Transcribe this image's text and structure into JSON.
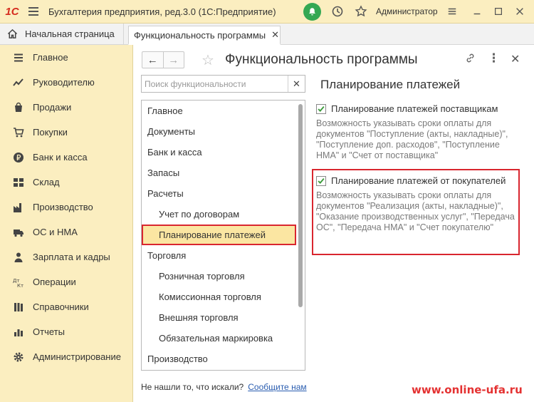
{
  "titlebar": {
    "logo": "1С",
    "app_title": "Бухгалтерия предприятия, ред.3.0  (1С:Предприятие)",
    "user_name": "Администратор"
  },
  "tabs": {
    "home_label": "Начальная страница",
    "active_label": "Функциональность программы",
    "close_glyph": "✕"
  },
  "sidebar": {
    "items": [
      {
        "label": "Главное",
        "icon": "menu-lines-icon"
      },
      {
        "label": "Руководителю",
        "icon": "trend-chart-icon"
      },
      {
        "label": "Продажи",
        "icon": "shopping-bag-icon"
      },
      {
        "label": "Покупки",
        "icon": "cart-icon"
      },
      {
        "label": "Банк и касса",
        "icon": "ruble-coin-icon"
      },
      {
        "label": "Склад",
        "icon": "warehouse-boxes-icon"
      },
      {
        "label": "Производство",
        "icon": "factory-icon"
      },
      {
        "label": "ОС и НМА",
        "icon": "truck-icon"
      },
      {
        "label": "Зарплата и кадры",
        "icon": "person-icon"
      },
      {
        "label": "Операции",
        "icon": "debit-credit-icon"
      },
      {
        "label": "Справочники",
        "icon": "books-icon"
      },
      {
        "label": "Отчеты",
        "icon": "bar-chart-icon"
      },
      {
        "label": "Администрирование",
        "icon": "gear-icon"
      }
    ]
  },
  "content": {
    "page_title": "Функциональность программы",
    "search_placeholder": "Поиск функциональности",
    "search_value": "",
    "tree": [
      {
        "label": "Главное",
        "level": 0
      },
      {
        "label": "Документы",
        "level": 0
      },
      {
        "label": "Банк и касса",
        "level": 0
      },
      {
        "label": "Запасы",
        "level": 0
      },
      {
        "label": "Расчеты",
        "level": 0
      },
      {
        "label": "Учет по договорам",
        "level": 1
      },
      {
        "label": "Планирование платежей",
        "level": 1,
        "selected": true
      },
      {
        "label": "Торговля",
        "level": 0
      },
      {
        "label": "Розничная торговля",
        "level": 1
      },
      {
        "label": "Комиссионная торговля",
        "level": 1
      },
      {
        "label": "Внешняя торговля",
        "level": 1
      },
      {
        "label": "Обязательная маркировка",
        "level": 1
      },
      {
        "label": "Производство",
        "level": 0
      }
    ],
    "not_found_text": "Не нашли то, что искали?",
    "not_found_link": "Сообщите нам",
    "section_title": "Планирование платежей",
    "options": [
      {
        "label": "Планирование платежей поставщикам",
        "checked": true,
        "description": "Возможность указывать сроки оплаты для документов \"Поступление (акты, накладные)\", \"Поступление доп. расходов\", \"Поступление НМА\" и \"Счет от поставщика\""
      },
      {
        "label": "Планирование платежей от покупателей",
        "checked": true,
        "description": "Возможность указывать сроки оплаты для документов \"Реализация (акты, накладные)\", \"Оказание производственных услуг\", \"Передача ОС\", \"Передача НМА\" и \"Счет покупателю\""
      }
    ]
  },
  "watermark": "www.online-ufa.ru",
  "colors": {
    "sidebar_bg": "#fbeec0",
    "selection_bg": "#fbe6a2",
    "highlight_border": "#d9262f",
    "checkbox_check": "#3a9a3a",
    "bell_bg": "#34a853",
    "link": "#2a5db0"
  }
}
